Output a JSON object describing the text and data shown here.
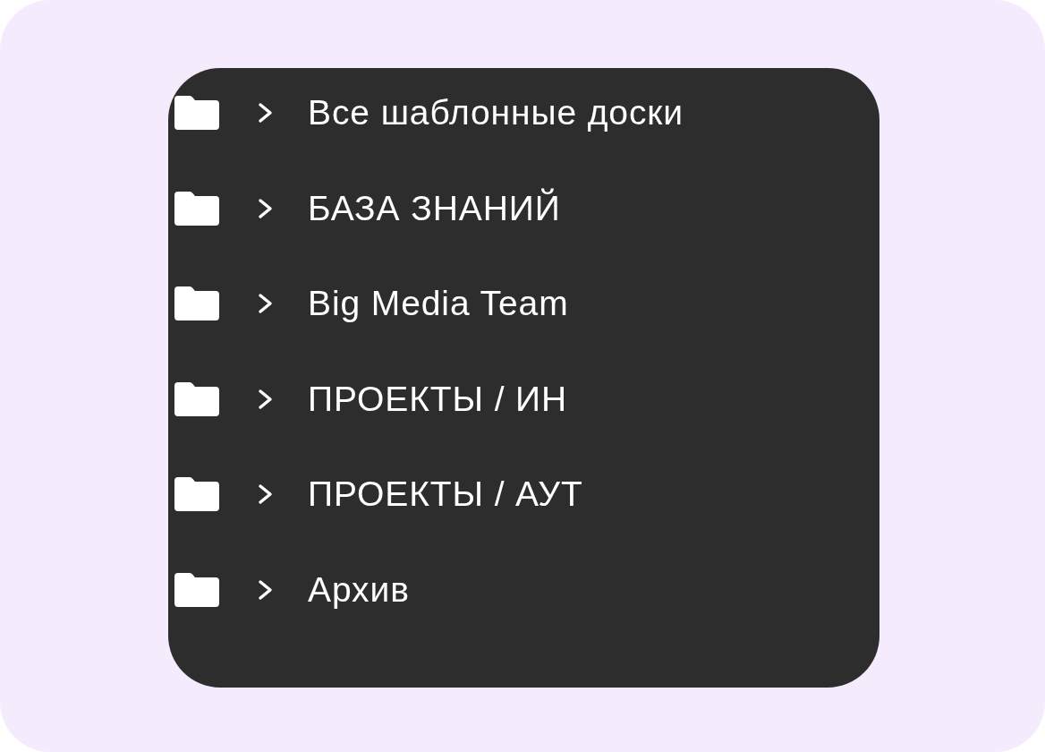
{
  "folders": [
    {
      "name": "Все шаблонные доски",
      "expanded": false
    },
    {
      "name": "БАЗА ЗНАНИЙ",
      "expanded": false
    },
    {
      "name": "Big Media Team",
      "expanded": false
    },
    {
      "name": "ПРОЕКТЫ / ИН",
      "expanded": false
    },
    {
      "name": "ПРОЕКТЫ / АУТ",
      "expanded": false
    },
    {
      "name": "Архив",
      "expanded": false
    }
  ]
}
